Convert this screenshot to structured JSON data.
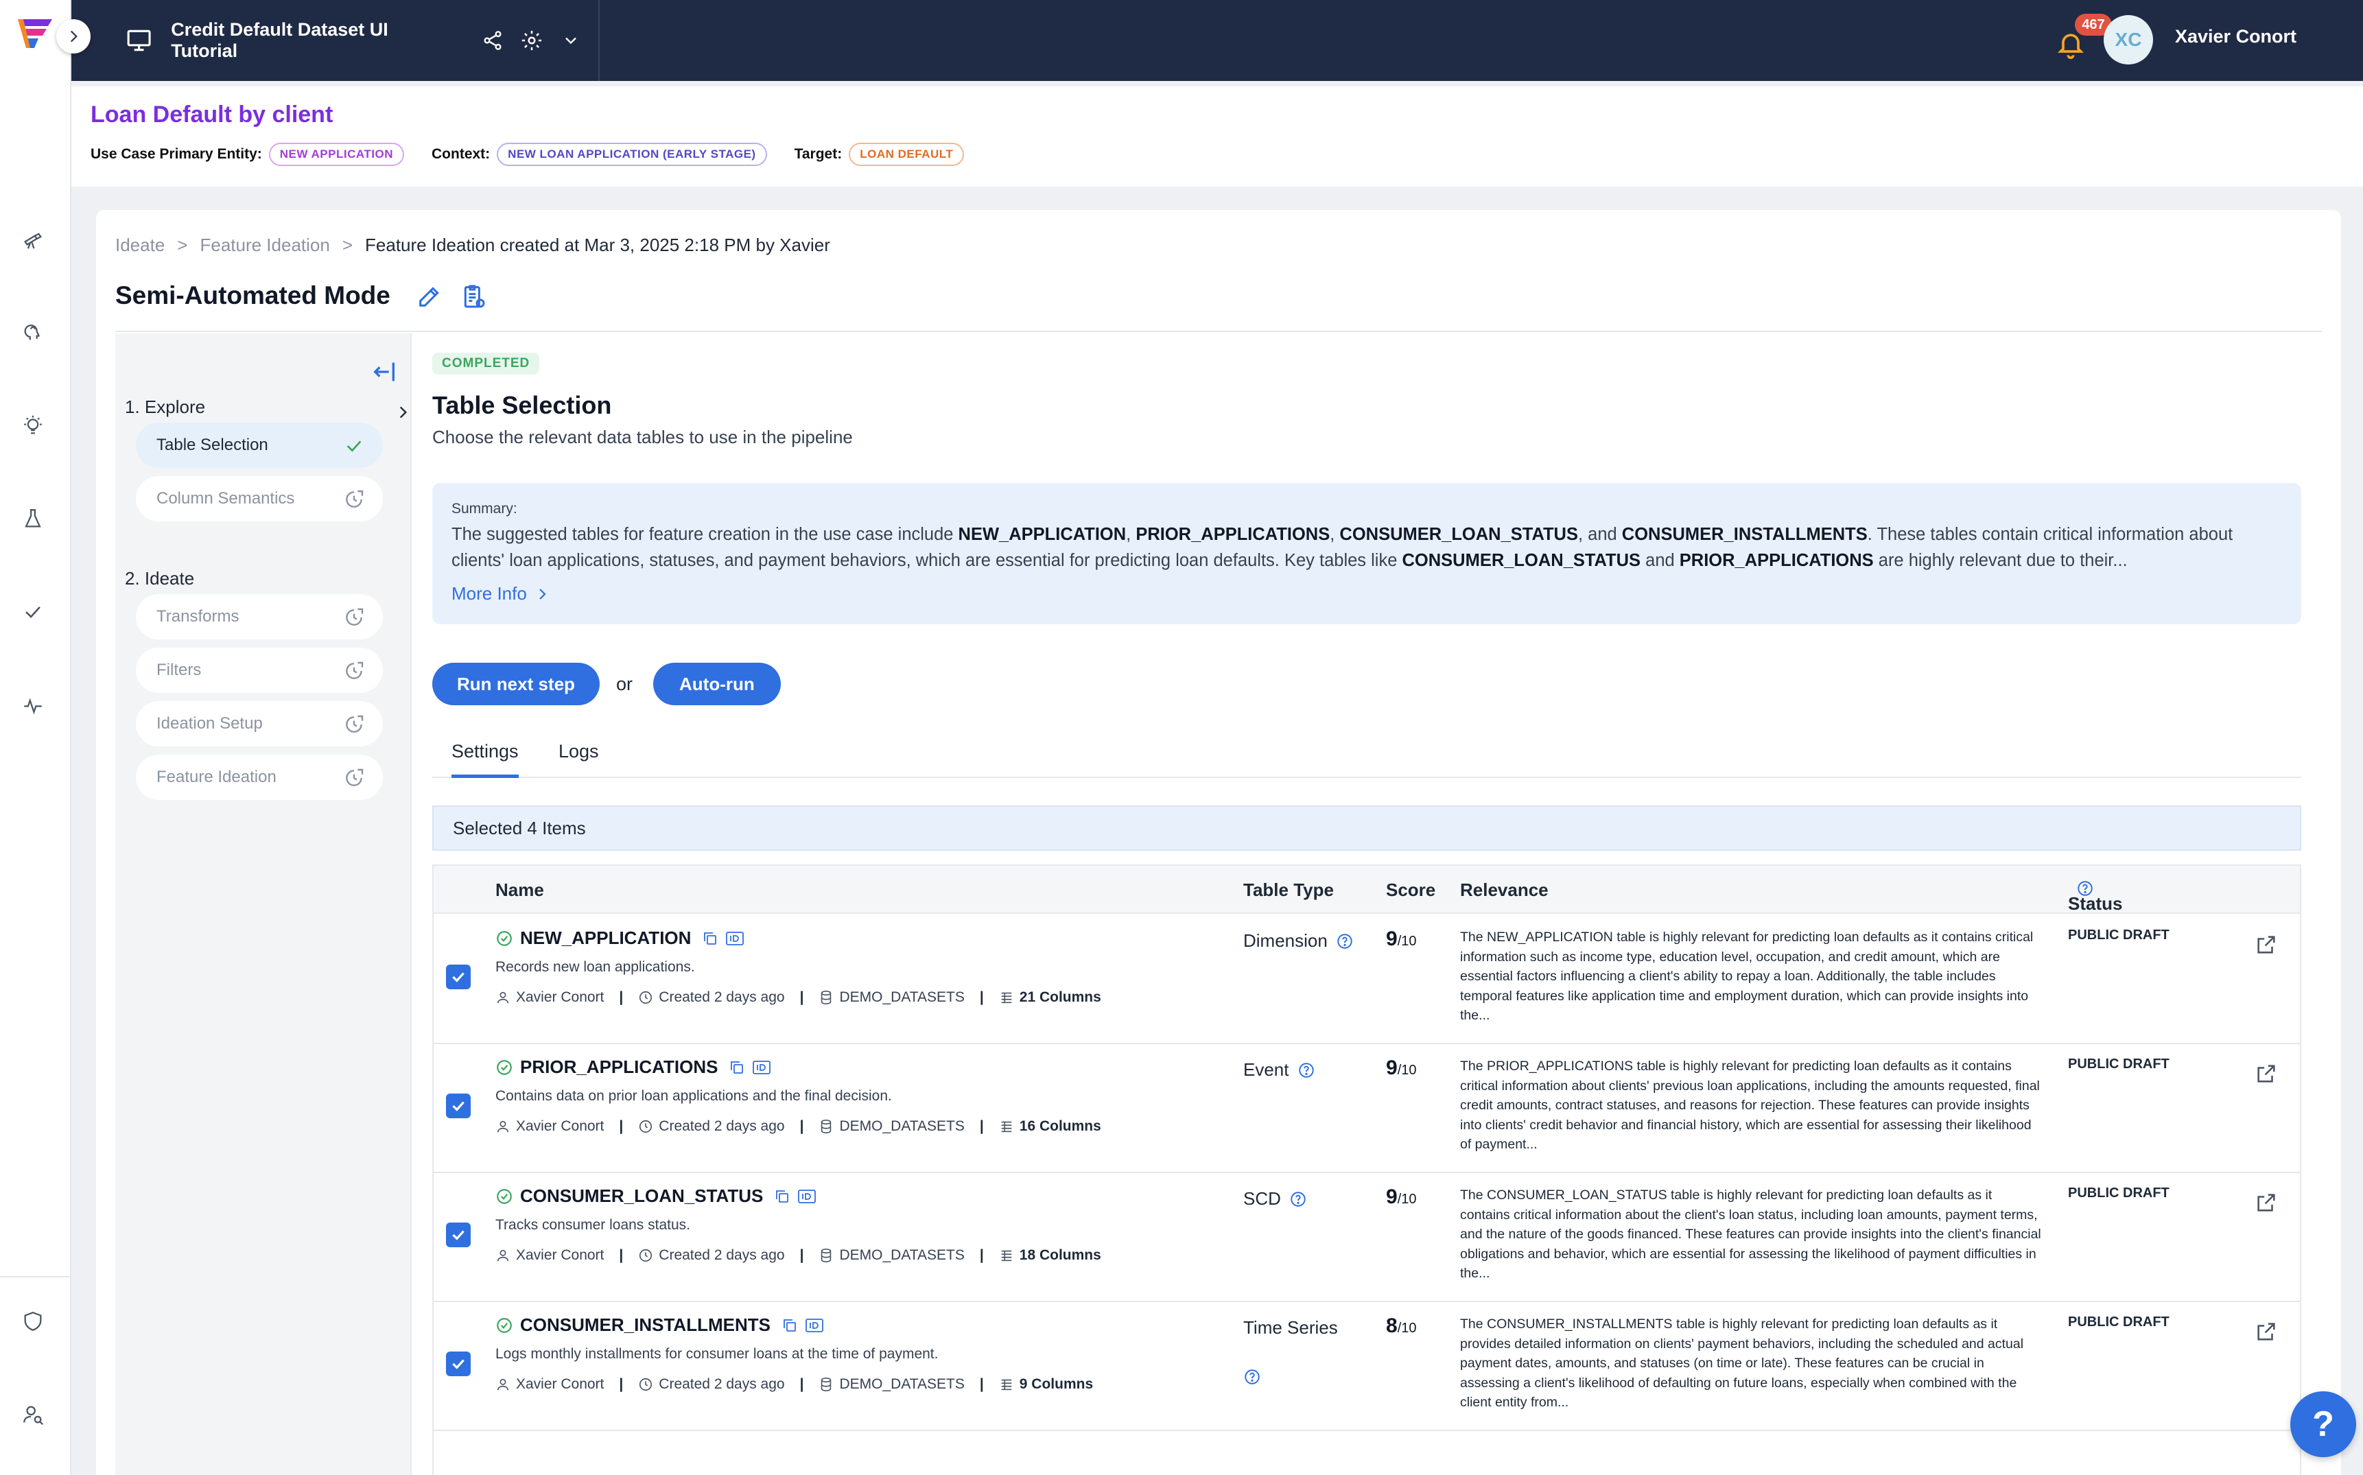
{
  "topbar": {
    "project_title": "Credit Default Dataset UI Tutorial",
    "notification_count": "467",
    "user_initials": "XC",
    "user_name": "Xavier Conort"
  },
  "use_case": {
    "title": "Loan Default by client",
    "entity_label": "Use Case Primary Entity:",
    "entity_tag": "NEW APPLICATION",
    "context_label": "Context:",
    "context_tag": "NEW LOAN APPLICATION (EARLY STAGE)",
    "target_label": "Target:",
    "target_tag": "LOAN DEFAULT"
  },
  "breadcrumb": {
    "items": [
      "Ideate",
      "Feature Ideation"
    ],
    "current": "Feature Ideation created at Mar 3, 2025 2:18 PM by Xavier",
    "separator": ">"
  },
  "mode_title": "Semi-Automated Mode",
  "steps": {
    "explore_label": "1. Explore",
    "explore_items": [
      "Table Selection",
      "Column Semantics"
    ],
    "ideate_label": "2. Ideate",
    "ideate_items": [
      "Transforms",
      "Filters",
      "Ideation Setup",
      "Feature Ideation"
    ]
  },
  "section": {
    "status": "COMPLETED",
    "title": "Table Selection",
    "subtitle": "Choose the relevant data tables to use in the pipeline"
  },
  "summary": {
    "label": "Summary:",
    "parts": [
      {
        "t": "The suggested tables for feature creation in the use case include ",
        "b": false
      },
      {
        "t": "NEW_APPLICATION",
        "b": true
      },
      {
        "t": ", ",
        "b": false
      },
      {
        "t": "PRIOR_APPLICATIONS",
        "b": true
      },
      {
        "t": ", ",
        "b": false
      },
      {
        "t": "CONSUMER_LOAN_STATUS",
        "b": true
      },
      {
        "t": ", and ",
        "b": false
      },
      {
        "t": "CONSUMER_INSTALLMENTS",
        "b": true
      },
      {
        "t": ". These tables contain critical information about clients' loan applications, statuses, and payment behaviors, which are essential for predicting loan defaults. Key tables like ",
        "b": false
      },
      {
        "t": "CONSUMER_LOAN_STATUS",
        "b": true
      },
      {
        "t": " and ",
        "b": false
      },
      {
        "t": "PRIOR_APPLICATIONS",
        "b": true
      },
      {
        "t": " are highly relevant due to their...",
        "b": false
      }
    ],
    "more_info": "More Info"
  },
  "actions": {
    "run_next": "Run next step",
    "or": "or",
    "auto_run": "Auto-run"
  },
  "tabs": [
    "Settings",
    "Logs"
  ],
  "selected_label": "Selected 4 Items",
  "table": {
    "headers": {
      "name": "Name",
      "type": "Table Type",
      "score": "Score",
      "relevance": "Relevance",
      "status": "Status"
    },
    "rows": [
      {
        "name": "NEW_APPLICATION",
        "desc": "Records new loan applications.",
        "owner": "Xavier Conort",
        "created": "Created 2 days ago",
        "source": "DEMO_DATASETS",
        "columns": "21 Columns",
        "type": "Dimension",
        "score": "9",
        "score_max": "/10",
        "relevance": "The NEW_APPLICATION table is highly relevant for predicting loan defaults as it contains critical information such as income type, education level, occupation, and credit amount, which are essential factors influencing a client's ability to repay a loan. Additionally, the table includes temporal features like application time and employment duration, which can provide insights into the...",
        "status": "PUBLIC DRAFT"
      },
      {
        "name": "PRIOR_APPLICATIONS",
        "desc": "Contains data on prior loan applications and the final decision.",
        "owner": "Xavier Conort",
        "created": "Created 2 days ago",
        "source": "DEMO_DATASETS",
        "columns": "16 Columns",
        "type": "Event",
        "score": "9",
        "score_max": "/10",
        "relevance": "The PRIOR_APPLICATIONS table is highly relevant for predicting loan defaults as it contains critical information about clients' previous loan applications, including the amounts requested, final credit amounts, contract statuses, and reasons for rejection. These features can provide insights into clients' credit behavior and financial history, which are essential for assessing their likelihood of payment...",
        "status": "PUBLIC DRAFT"
      },
      {
        "name": "CONSUMER_LOAN_STATUS",
        "desc": "Tracks consumer loans status.",
        "owner": "Xavier Conort",
        "created": "Created 2 days ago",
        "source": "DEMO_DATASETS",
        "columns": "18 Columns",
        "type": "SCD",
        "score": "9",
        "score_max": "/10",
        "relevance": "The CONSUMER_LOAN_STATUS table is highly relevant for predicting loan defaults as it contains critical information about the client's loan status, including loan amounts, payment terms, and the nature of the goods financed. These features can provide insights into the client's financial obligations and behavior, which are essential for assessing the likelihood of payment difficulties in the...",
        "status": "PUBLIC DRAFT"
      },
      {
        "name": "CONSUMER_INSTALLMENTS",
        "desc": "Logs monthly installments for consumer loans at the time of payment.",
        "owner": "Xavier Conort",
        "created": "Created 2 days ago",
        "source": "DEMO_DATASETS",
        "columns": "9 Columns",
        "type": "Time Series",
        "score": "8",
        "score_max": "/10",
        "relevance": "The CONSUMER_INSTALLMENTS table is highly relevant for predicting loan defaults as it provides detailed information on clients' payment behaviors, including the scheduled and actual payment dates, amounts, and statuses (on time or late). These features can be crucial in assessing a client's likelihood of defaulting on future loans, especially when combined with the client entity from...",
        "status": "PUBLIC DRAFT"
      }
    ]
  },
  "help": "?"
}
